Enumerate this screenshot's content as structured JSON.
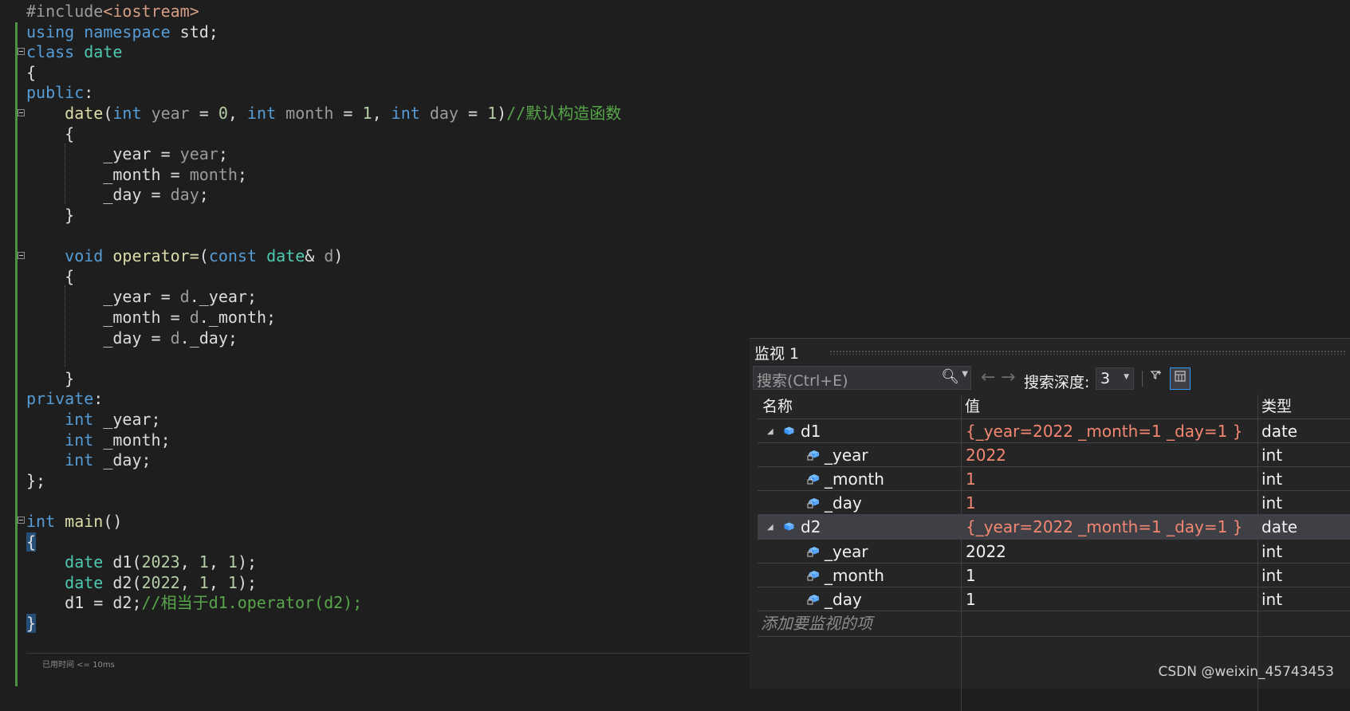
{
  "editor": {
    "lines": [
      [
        [
          "pp",
          "#include"
        ],
        [
          "st",
          "<iostream>"
        ]
      ],
      [
        [
          "kw",
          "using"
        ],
        [
          "pb",
          " "
        ],
        [
          "kw",
          "namespace"
        ],
        [
          "pb",
          " std;"
        ]
      ],
      [
        [
          "kw",
          "class"
        ],
        [
          "pb",
          " "
        ],
        [
          "ty",
          "date"
        ]
      ],
      [
        [
          "pb",
          "{"
        ]
      ],
      [
        [
          "kw",
          "public"
        ],
        [
          "pb",
          ":"
        ]
      ],
      [
        [
          "pb",
          "    "
        ],
        [
          "fn",
          "date"
        ],
        [
          "pb",
          "("
        ],
        [
          "kw",
          "int"
        ],
        [
          "pb",
          " "
        ],
        [
          "pm",
          "year"
        ],
        [
          "pb",
          " = "
        ],
        [
          "nm",
          "0"
        ],
        [
          "pb",
          ", "
        ],
        [
          "kw",
          "int"
        ],
        [
          "pb",
          " "
        ],
        [
          "pm",
          "month"
        ],
        [
          "pb",
          " = "
        ],
        [
          "nm",
          "1"
        ],
        [
          "pb",
          ", "
        ],
        [
          "kw",
          "int"
        ],
        [
          "pb",
          " "
        ],
        [
          "pm",
          "day"
        ],
        [
          "pb",
          " = "
        ],
        [
          "nm",
          "1"
        ],
        [
          "pb",
          ")"
        ],
        [
          "cm",
          "//默认构造函数"
        ]
      ],
      [
        [
          "pb",
          "    {"
        ]
      ],
      [
        [
          "pb",
          "        _year = "
        ],
        [
          "pm",
          "year"
        ],
        [
          "pb",
          ";"
        ]
      ],
      [
        [
          "pb",
          "        _month = "
        ],
        [
          "pm",
          "month"
        ],
        [
          "pb",
          ";"
        ]
      ],
      [
        [
          "pb",
          "        _day = "
        ],
        [
          "pm",
          "day"
        ],
        [
          "pb",
          ";"
        ]
      ],
      [
        [
          "pb",
          "    }"
        ]
      ],
      [
        [
          "pb",
          ""
        ]
      ],
      [
        [
          "pb",
          "    "
        ],
        [
          "kw",
          "void"
        ],
        [
          "pb",
          " "
        ],
        [
          "fn",
          "operator="
        ],
        [
          "pb",
          "("
        ],
        [
          "kw",
          "const"
        ],
        [
          "pb",
          " "
        ],
        [
          "ty",
          "date"
        ],
        [
          "pb",
          "& "
        ],
        [
          "pm",
          "d"
        ],
        [
          "pb",
          ")"
        ]
      ],
      [
        [
          "pb",
          "    {"
        ]
      ],
      [
        [
          "pb",
          "        _year = "
        ],
        [
          "pm",
          "d"
        ],
        [
          "pb",
          "._year;"
        ]
      ],
      [
        [
          "pb",
          "        _month = "
        ],
        [
          "pm",
          "d"
        ],
        [
          "pb",
          "._month;"
        ]
      ],
      [
        [
          "pb",
          "        _day = "
        ],
        [
          "pm",
          "d"
        ],
        [
          "pb",
          "._day;"
        ]
      ],
      [
        [
          "pb",
          ""
        ]
      ],
      [
        [
          "pb",
          "    }"
        ]
      ],
      [
        [
          "kw",
          "private"
        ],
        [
          "pb",
          ":"
        ]
      ],
      [
        [
          "pb",
          "    "
        ],
        [
          "kw",
          "int"
        ],
        [
          "pb",
          " _year;"
        ]
      ],
      [
        [
          "pb",
          "    "
        ],
        [
          "kw",
          "int"
        ],
        [
          "pb",
          " _month;"
        ]
      ],
      [
        [
          "pb",
          "    "
        ],
        [
          "kw",
          "int"
        ],
        [
          "pb",
          " _day;"
        ]
      ],
      [
        [
          "pb",
          "};"
        ]
      ],
      [
        [
          "pb",
          ""
        ]
      ],
      [
        [
          "kw",
          "int"
        ],
        [
          "pb",
          " "
        ],
        [
          "fn",
          "main"
        ],
        [
          "pb",
          "()"
        ]
      ],
      [
        [
          "hlbrace",
          "{"
        ]
      ],
      [
        [
          "pb",
          "    "
        ],
        [
          "ty",
          "date"
        ],
        [
          "pb",
          " d1("
        ],
        [
          "nm",
          "2023"
        ],
        [
          "pb",
          ", "
        ],
        [
          "nm",
          "1"
        ],
        [
          "pb",
          ", "
        ],
        [
          "nm",
          "1"
        ],
        [
          "pb",
          ");"
        ]
      ],
      [
        [
          "pb",
          "    "
        ],
        [
          "ty",
          "date"
        ],
        [
          "pb",
          " d2("
        ],
        [
          "nm",
          "2022"
        ],
        [
          "pb",
          ", "
        ],
        [
          "nm",
          "1"
        ],
        [
          "pb",
          ", "
        ],
        [
          "nm",
          "1"
        ],
        [
          "pb",
          ");"
        ]
      ],
      [
        [
          "pb",
          "    d1 = d2;"
        ],
        [
          "cm",
          "//相当于d1.operator(d2);"
        ]
      ],
      [
        [
          "hlbrace",
          "}"
        ]
      ]
    ],
    "elapsed_hint": "已用时间 <= 10ms"
  },
  "watch": {
    "title": "监视 1",
    "search_placeholder": "搜索(Ctrl+E)",
    "depth_label": "搜索深度:",
    "depth_value": "3",
    "columns": {
      "name": "名称",
      "value": "值",
      "type": "类型"
    },
    "rows": [
      {
        "name": "d1",
        "value": "{_year=2022 _month=1 _day=1 }",
        "type": "date",
        "level": 0,
        "value_color": "red"
      },
      {
        "name": "_year",
        "value": "2022",
        "type": "int",
        "level": 1,
        "value_color": "red"
      },
      {
        "name": "_month",
        "value": "1",
        "type": "int",
        "level": 1,
        "value_color": "red"
      },
      {
        "name": "_day",
        "value": "1",
        "type": "int",
        "level": 1,
        "value_color": "red"
      },
      {
        "name": "d2",
        "value": "{_year=2022 _month=1 _day=1 }",
        "type": "date",
        "level": 0,
        "value_color": "red",
        "selected": true
      },
      {
        "name": "_year",
        "value": "2022",
        "type": "int",
        "level": 1,
        "value_color": "white"
      },
      {
        "name": "_month",
        "value": "1",
        "type": "int",
        "level": 1,
        "value_color": "white"
      },
      {
        "name": "_day",
        "value": "1",
        "type": "int",
        "level": 1,
        "value_color": "white"
      }
    ],
    "add_watch_placeholder": "添加要监视的项"
  },
  "watermark": "CSDN @weixin_45743453",
  "colors": {
    "keyword": "#569cd6",
    "type": "#4ec9b0",
    "function": "#dcdcaa",
    "comment": "#57a64a",
    "value_changed": "#f48771"
  }
}
